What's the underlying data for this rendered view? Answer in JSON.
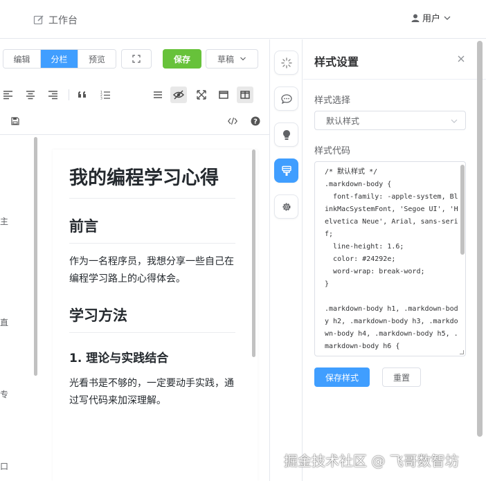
{
  "header": {
    "workbench_label": "工作台",
    "user_label": "用户"
  },
  "editor": {
    "modes": [
      "编辑",
      "分栏",
      "预览"
    ],
    "active_mode": "分栏",
    "save_label": "保存",
    "draft_label": "草稿"
  },
  "preview": {
    "h1": "我的编程学习心得",
    "h2_intro": "前言",
    "intro_text": "作为一名程序员，我想分享一些自己在编程学习路上的心得体会。",
    "h2_methods": "学习方法",
    "h3_theory": "1. 理论与实践结合",
    "theory_text": "光看书是不够的，一定要动手实践，通过写代码来加深理解。"
  },
  "left_edge_chars": [
    "主",
    "直",
    "专",
    "口"
  ],
  "style_panel": {
    "title": "样式设置",
    "select_label": "样式选择",
    "select_value": "默认样式",
    "code_label": "样式代码",
    "code": "/* 默认样式 */\n.markdown-body {\n  font-family: -apple-system, BlinkMacSystemFont, 'Segoe UI', 'Helvetica Neue', Arial, sans-serif;\n  line-height: 1.6;\n  color: #24292e;\n  word-wrap: break-word;\n}\n\n.markdown-body h1, .markdown-body h2, .markdown-body h3, .markdown-body h4, .markdown-body h5, .markdown-body h6 {",
    "save_style_label": "保存样式",
    "reset_label": "重置"
  },
  "watermark": "掘金技术社区 @ 飞哥数智坊",
  "colors": {
    "primary": "#409eff",
    "success": "#67c23a",
    "border": "#dcdfe6"
  }
}
